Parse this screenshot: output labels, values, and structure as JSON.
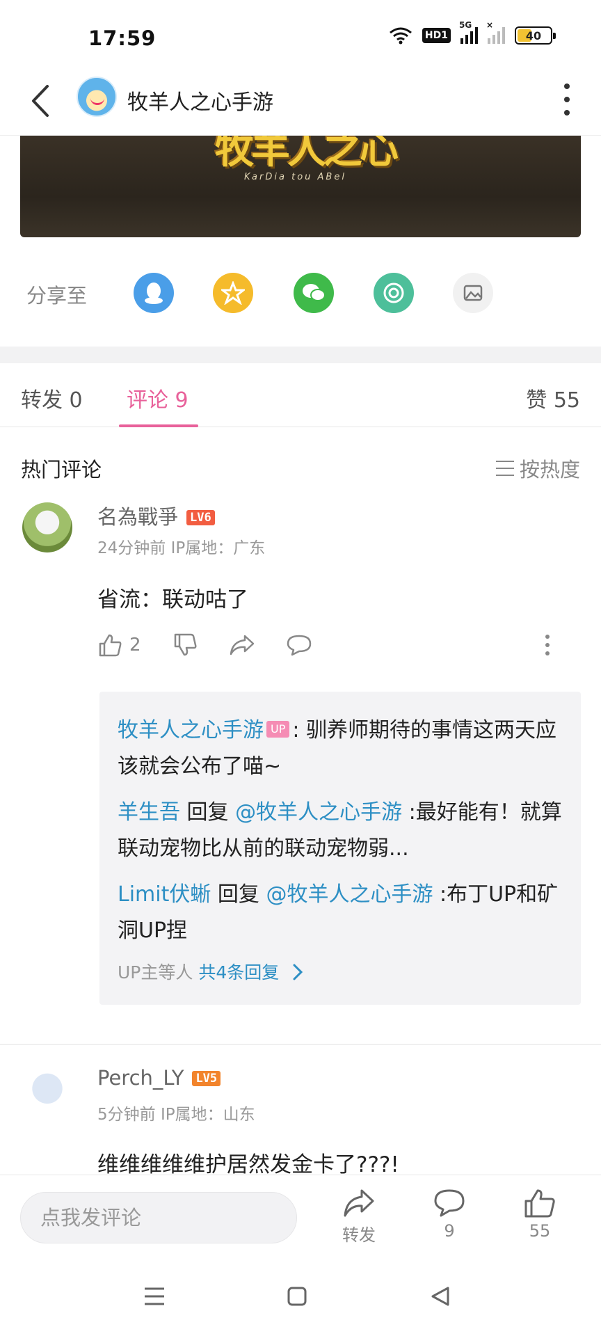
{
  "status": {
    "time": "17:59",
    "battery": "40",
    "signal1_label": "5G",
    "signal2_label": "×",
    "hd": "HD1"
  },
  "header": {
    "title": "牧羊人之心手游"
  },
  "banner": {
    "logo_text": "牧羊人之心",
    "logo_sub": "KarDia tou ABel"
  },
  "share": {
    "label": "分享至",
    "targets": [
      "qq-icon",
      "qzone-icon",
      "wechat-icon",
      "moments-icon",
      "gallery-icon"
    ]
  },
  "tabs": {
    "forward": "转发 0",
    "comments": "评论 9",
    "likes": "赞 55"
  },
  "comments_section": {
    "title": "热门评论",
    "sort": "按热度"
  },
  "comments": [
    {
      "name": "名為戰爭",
      "level": "LV6",
      "meta": "24分钟前  IP属地：广东",
      "text": "省流：联动咕了",
      "like_count": "2",
      "replies": [
        {
          "user": "牧羊人之心手游",
          "badge": "UP",
          "text": ": 驯养师期待的事情这两天应该就会公布了喵~"
        },
        {
          "user": "羊生吾",
          "reply_word": " 回复 ",
          "target": "@牧羊人之心手游",
          "text": " :最好能有！就算联动宠物比从前的联动宠物弱..."
        },
        {
          "user": "Limit伏蜥",
          "reply_word": " 回复 ",
          "target": "@牧羊人之心手游",
          "text": " :布丁UP和矿洞UP捏"
        }
      ],
      "replies_more_prefix": "UP主等人 ",
      "replies_more_count": "共4条回复"
    },
    {
      "name": "Perch_LY",
      "level": "LV5",
      "meta": "5分钟前  IP属地：山东",
      "text": "维维维维维护居然发金卡了???!"
    }
  ],
  "bottom_bar": {
    "input_placeholder": "点我发评论",
    "forward_label": "转发",
    "comment_count": "9",
    "like_count": "55"
  },
  "colors": {
    "accent": "#e8619a",
    "link": "#2d8fc4",
    "qq": "#4a9ee8",
    "qzone": "#f5bb2b",
    "wechat": "#3fba4a",
    "moments": "#4dbf9a"
  }
}
